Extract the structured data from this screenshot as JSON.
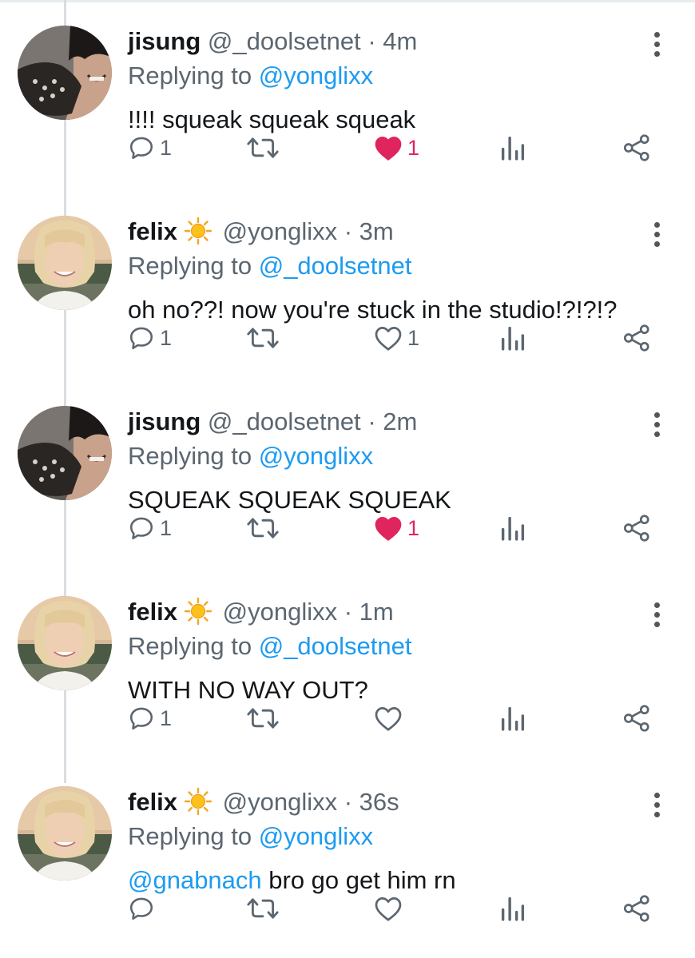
{
  "tweets": [
    {
      "name": "jisung",
      "handle": "@_doolsetnet",
      "time": "· 4m",
      "has_sun": false,
      "avatar": "jisung",
      "replying_prefix": "Replying to",
      "replying_to": "@yonglixx",
      "mention": "",
      "text": "!!!! squeak squeak squeak",
      "reply_count": "1",
      "like_count": "1",
      "liked": true
    },
    {
      "name": "felix",
      "handle": "@yonglixx",
      "time": "· 3m",
      "has_sun": true,
      "avatar": "felix",
      "replying_prefix": "Replying to",
      "replying_to": "@_doolsetnet",
      "mention": "",
      "text": "oh no??! now you're stuck in the studio!?!?!?",
      "reply_count": "1",
      "like_count": "1",
      "liked": false
    },
    {
      "name": "jisung",
      "handle": "@_doolsetnet",
      "time": "· 2m",
      "has_sun": false,
      "avatar": "jisung",
      "replying_prefix": "Replying to",
      "replying_to": "@yonglixx",
      "mention": "",
      "text": "SQUEAK SQUEAK SQUEAK",
      "reply_count": "1",
      "like_count": "1",
      "liked": true
    },
    {
      "name": "felix",
      "handle": "@yonglixx",
      "time": "· 1m",
      "has_sun": true,
      "avatar": "felix",
      "replying_prefix": "Replying to",
      "replying_to": "@_doolsetnet",
      "mention": "",
      "text": "WITH NO WAY OUT?",
      "reply_count": "1",
      "like_count": "",
      "liked": false
    },
    {
      "name": "felix",
      "handle": "@yonglixx",
      "time": "· 36s",
      "has_sun": true,
      "avatar": "felix",
      "replying_prefix": "Replying to",
      "replying_to": "@yonglixx",
      "mention": "@gnabnach",
      "text": " bro go get him rn",
      "reply_count": "",
      "like_count": "",
      "liked": false
    }
  ],
  "icons": {
    "reply": "reply-icon",
    "retweet": "retweet-icon",
    "like": "heart-icon",
    "analytics": "analytics-icon",
    "share": "share-icon",
    "more": "more-vertical-icon",
    "sun": "sun-emoji-icon"
  },
  "colors": {
    "link": "#1d9bf0",
    "liked": "#e0245e",
    "muted": "#5b6670",
    "text": "#14171a"
  }
}
